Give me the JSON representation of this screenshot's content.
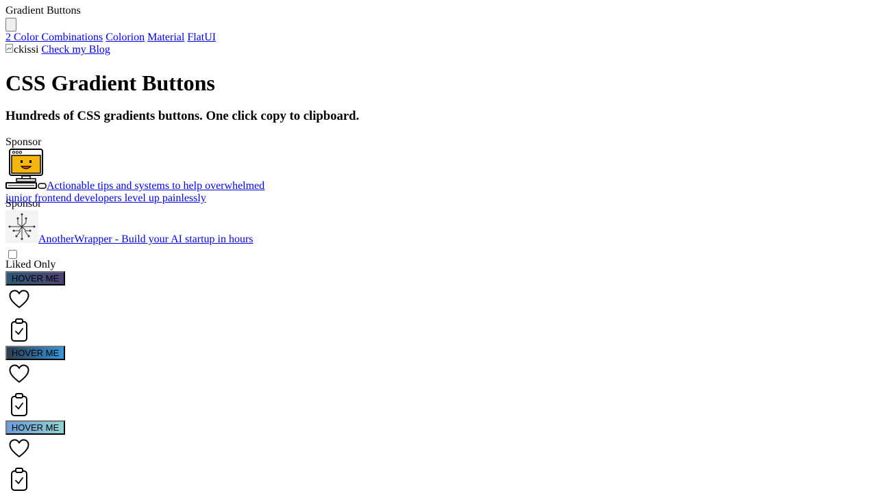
{
  "app": {
    "title": "Gradient Buttons"
  },
  "nav": {
    "links": [
      "2 Color Combinations",
      "Colorion",
      "Material",
      "FlatUI"
    ]
  },
  "author": {
    "image_alt": "ckissi",
    "blog_link": "Check my Blog"
  },
  "hero": {
    "title": "CSS Gradient Buttons",
    "subtitle": "Hundreds of CSS gradients buttons. One click copy to clipboard."
  },
  "sponsors": [
    {
      "label": "Sponsor",
      "text_line1": "Actionable tips and systems to help overwhelmed",
      "text_line2": "junior frontend developers level up painlessly"
    },
    {
      "label": "Sponsor",
      "text": "AnotherWrapper - Build your AI startup in hours"
    }
  ],
  "filter": {
    "liked_only_label": "Liked Only",
    "liked_only_checked": false
  },
  "buttons": [
    {
      "label": "HOVER ME",
      "gradient_from": "#2b5876",
      "gradient_to": "#4e4376",
      "icons": [
        "heart-icon",
        "clipboard-check-icon"
      ]
    },
    {
      "label": "HOVER ME",
      "gradient_from": "#2c3e50",
      "gradient_to": "#3498db",
      "icons": [
        "heart-icon",
        "clipboard-check-icon"
      ]
    },
    {
      "label": "HOVER ME",
      "gradient_from": "#6a9bd8",
      "gradient_to": "#8fd3d1",
      "icons": [
        "heart-icon",
        "clipboard-check-icon"
      ]
    }
  ]
}
